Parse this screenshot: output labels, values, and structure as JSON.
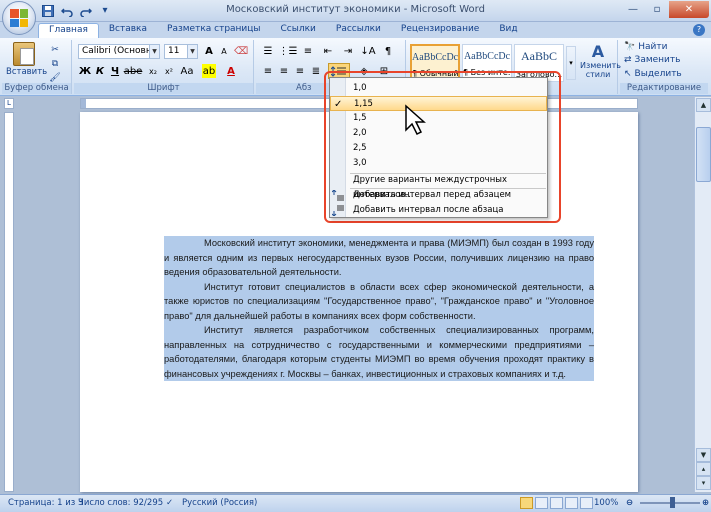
{
  "app": {
    "title": "Московский институт экономики - Microsoft Word"
  },
  "qat": {
    "save_icon": "save-icon",
    "undo_icon": "undo-icon",
    "redo_icon": "redo-icon",
    "more_icon": "dropdown-icon"
  },
  "tabs": [
    {
      "label": "Главная",
      "active": true
    },
    {
      "label": "Вставка"
    },
    {
      "label": "Разметка страницы"
    },
    {
      "label": "Ссылки"
    },
    {
      "label": "Рассылки"
    },
    {
      "label": "Рецензирование"
    },
    {
      "label": "Вид"
    }
  ],
  "ribbon": {
    "clipboard": {
      "paste_label": "Вставить",
      "group_label": "Буфер обмена"
    },
    "font": {
      "font_name": "Calibri (Основной те",
      "font_size": "11",
      "group_label": "Шрифт"
    },
    "paragraph": {
      "group_label": "Абз"
    },
    "styles": {
      "items": [
        {
          "sample": "AaBbCcDc",
          "name": "¶ Обычный"
        },
        {
          "sample": "AaBbCcDc",
          "name": "¶ Без инте..."
        },
        {
          "sample": "AaBbC",
          "name": "Заголово..."
        }
      ],
      "change_styles_label": "Изменить стили"
    },
    "editing": {
      "find_label": "Найти",
      "replace_label": "Заменить",
      "select_label": "Выделить",
      "group_label": "Редактирование"
    }
  },
  "line_spacing_menu": {
    "items": [
      "1,0",
      "1,15",
      "1,5",
      "2,0",
      "2,5",
      "3,0"
    ],
    "checked": "1,15",
    "more_options": "Другие варианты междустрочных интервалов...",
    "add_before": "Добавить интервал перед абзацем",
    "add_after": "Добавить интервал после абзаца"
  },
  "document": {
    "paragraphs": [
      "Московский институт экономики, менеджмента и права (МИЭМП) был создан в 1993 году и является одним из первых негосударственных вузов России, получивших лицензию на право ведения образовательной деятельности.",
      "Институт готовит специалистов в области всех сфер экономической деятельности, а также юристов по специализациям \"Государственное право\", \"Гражданское право\" и \"Уголовное право\" для дальнейшей работы в компаниях всех форм собственности.",
      "Институт является разработчиком собственных специализированных программ, направленных на сотрудничество с государственными и коммерческими предприятиями – работодателями, благодаря которым студенты МИЭМП во время обучения проходят практику в финансовых учреждениях г. Москвы – банках, инвестиционных и страховых компаниях и т.д."
    ]
  },
  "status": {
    "page": "Страница: 1 из 3",
    "words": "Число слов: 92/295",
    "language": "Русский (Россия)",
    "zoom": "100%"
  },
  "colors": {
    "accent": "#15428b",
    "selection": "#b2cbea",
    "highlight_box": "#e8442a"
  }
}
